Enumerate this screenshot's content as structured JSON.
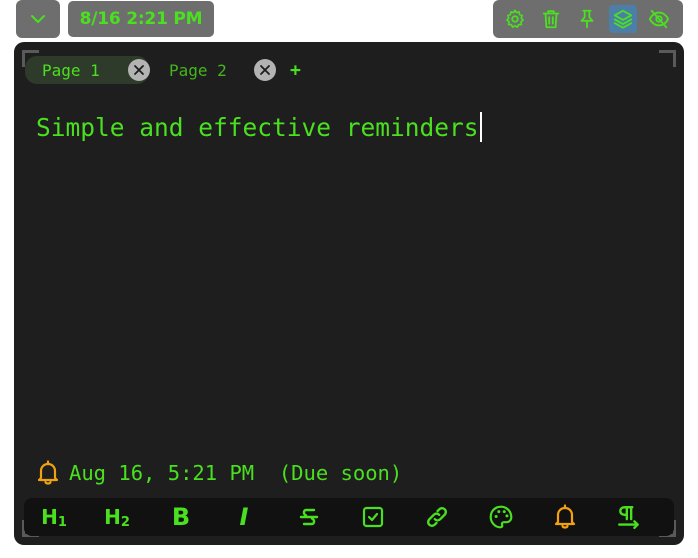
{
  "topbar": {
    "collapse_icon": "chevron-down-icon",
    "datetime": "8/16 2:21 PM",
    "actions": [
      "gear-icon",
      "trash-icon",
      "pin-icon",
      "layers-icon",
      "eye-off-icon"
    ]
  },
  "tabs": [
    {
      "label": "Page 1",
      "active": true
    },
    {
      "label": "Page 2",
      "active": false
    }
  ],
  "add_tab_label": "+",
  "editor": {
    "content": "Simple and effective reminders"
  },
  "reminder": {
    "text": "Aug 16, 5:21 PM  (Due soon)",
    "icon": "bell-icon"
  },
  "toolbar": {
    "h1": "H",
    "h1_sub": "1",
    "h2": "H",
    "h2_sub": "2",
    "bold": "B",
    "italic": "I",
    "items": [
      "heading1-icon",
      "heading2-icon",
      "bold-icon",
      "italic-icon",
      "strikethrough-icon",
      "checkbox-icon",
      "link-icon",
      "palette-icon",
      "bell-icon",
      "paragraph-direction-icon"
    ]
  },
  "colors": {
    "accent": "#4ae01f",
    "panel": "#1e1e1e",
    "toolbar_bg": "#6e6e6e",
    "reminder_icon": "#f2a111",
    "active_action": "#4b7fa8"
  }
}
